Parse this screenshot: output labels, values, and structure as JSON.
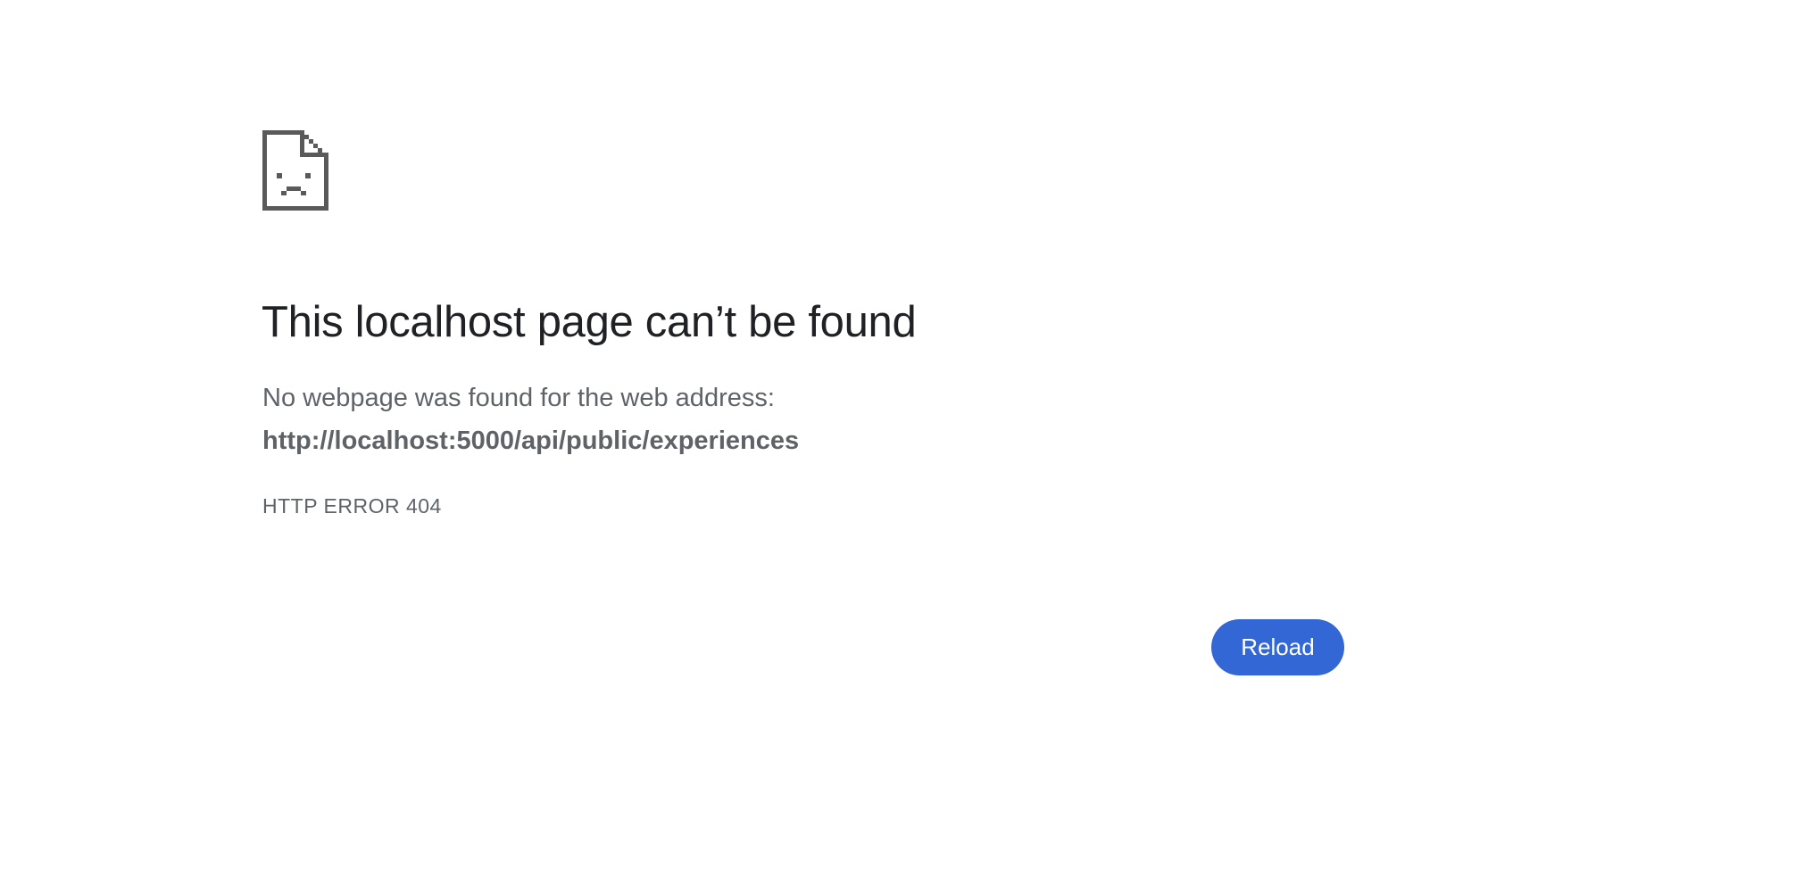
{
  "error": {
    "icon": "sad-page-icon",
    "heading": "This localhost page can’t be found",
    "description": "No webpage was found for the web address:",
    "url": "http://localhost:5000/api/public/experiences",
    "code": "HTTP ERROR 404"
  },
  "actions": {
    "reload_label": "Reload"
  },
  "colors": {
    "background": "#ffffff",
    "heading_text": "#202124",
    "body_text": "#5f6368",
    "icon": "#5a5a5a",
    "button_bg": "#3367d6",
    "button_text": "#ffffff"
  }
}
